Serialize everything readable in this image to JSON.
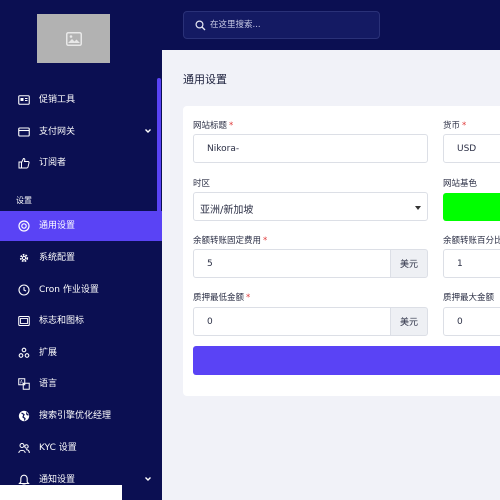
{
  "topbar": {
    "search_placeholder": "在这里搜索..."
  },
  "sidebar": {
    "logo_icon": "image-placeholder-icon",
    "section_label": "设置",
    "items": [
      {
        "label": "促销工具",
        "icon": "promo-card-icon",
        "chevron": false,
        "active": false
      },
      {
        "label": "支付网关",
        "icon": "credit-card-icon",
        "chevron": true,
        "active": false
      },
      {
        "label": "订阅者",
        "icon": "thumbs-up-icon",
        "chevron": false,
        "active": false
      },
      {
        "label": "通用设置",
        "icon": "target-icon",
        "chevron": false,
        "active": true
      },
      {
        "label": "系统配置",
        "icon": "gear-icon",
        "chevron": false,
        "active": false
      },
      {
        "label": "Cron 作业设置",
        "icon": "clock-icon",
        "chevron": false,
        "active": false
      },
      {
        "label": "标志和图标",
        "icon": "image-icon",
        "chevron": false,
        "active": false
      },
      {
        "label": "扩展",
        "icon": "puzzle-icon",
        "chevron": false,
        "active": false
      },
      {
        "label": "语言",
        "icon": "language-icon",
        "chevron": false,
        "active": false
      },
      {
        "label": "搜索引擎优化经理",
        "icon": "globe-icon",
        "chevron": false,
        "active": false
      },
      {
        "label": "KYC 设置",
        "icon": "users-icon",
        "chevron": false,
        "active": false
      },
      {
        "label": "通知设置",
        "icon": "bell-icon",
        "chevron": true,
        "active": false
      }
    ]
  },
  "main": {
    "title": "通用设置",
    "fields": {
      "site_title": {
        "label": "网站标题",
        "value": "Nikora-"
      },
      "currency": {
        "label": "货币",
        "value": "USD"
      },
      "timezone": {
        "label": "时区",
        "value": "亚洲/新加坡"
      },
      "site_color": {
        "label": "网站基色",
        "value": "#00ff00"
      },
      "fixed_charge": {
        "label": "余额转账固定费用",
        "value": "5",
        "addon": "美元"
      },
      "percent_charge": {
        "label": "余额转账百分比",
        "value": "1"
      },
      "min_pledge": {
        "label": "质押最低金额",
        "value": "0",
        "addon": "美元"
      },
      "max_pledge": {
        "label": "质押最大金额",
        "value": "0"
      }
    },
    "submit_label": ""
  }
}
